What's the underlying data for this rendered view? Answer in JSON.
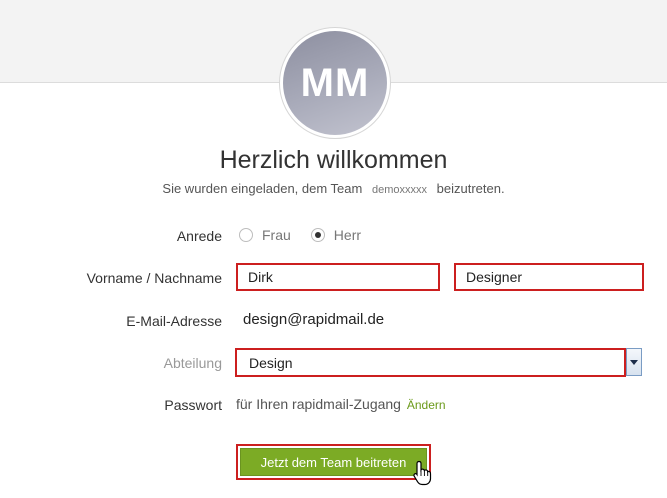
{
  "avatar": {
    "initials": "MM"
  },
  "welcome": {
    "title": "Herzlich willkommen",
    "subtitle_before": "Sie wurden eingeladen, dem Team",
    "team_name": "demoxxxxx",
    "subtitle_after": "beizutreten."
  },
  "form": {
    "salutation": {
      "label": "Anrede",
      "options": [
        {
          "label": "Frau",
          "selected": false
        },
        {
          "label": "Herr",
          "selected": true
        }
      ]
    },
    "name": {
      "label": "Vorname / Nachname",
      "first_name": "Dirk",
      "last_name": "Designer"
    },
    "email": {
      "label": "E-Mail-Adresse",
      "value": "design@rapidmail.de"
    },
    "department": {
      "label": "Abteilung",
      "selected": "Design"
    },
    "password": {
      "label": "Passwort",
      "text": "für Ihren rapidmail-Zugang",
      "change_link": "Ändern"
    },
    "submit_label": "Jetzt dem Team beitreten"
  },
  "colors": {
    "accent_green": "#7cab25",
    "highlight_red": "#cc1f1f",
    "link_green": "#6b9a1a"
  }
}
